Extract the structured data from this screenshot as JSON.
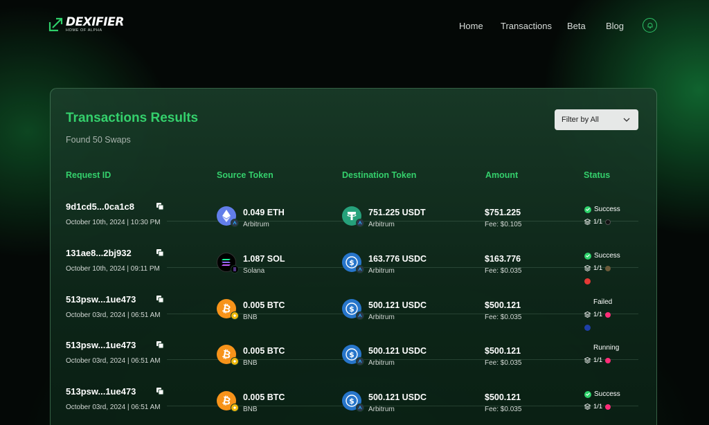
{
  "brand": {
    "name": "DEXIFIER",
    "tagline": "HOME OF ALPHA",
    "accent": "#34d06c"
  },
  "nav": {
    "items": [
      "Home",
      "Transactions",
      "Beta",
      "Blog"
    ],
    "bell_icon": "bell-icon"
  },
  "results": {
    "title": "Transactions Results",
    "subtitle": "Found 50 Swaps",
    "filter_label": "Filter by All",
    "columns": [
      "Request ID",
      "Source Token",
      "Destination Token",
      "Amount",
      "Status"
    ],
    "rows": [
      {
        "id": "9d1cd5...0ca1c8",
        "date": "October 10th, 2024 | 10:30 PM",
        "src_amount": "0.049 ETH",
        "src_network": "Arbitrum",
        "src_icon": "eth-icon",
        "dst_amount": "751.225 USDT",
        "dst_network": "Arbitrum",
        "dst_icon": "usdt-icon",
        "price": "$751.225",
        "fee": "Fee: $0.105",
        "status": "Success",
        "steps": "1/1"
      },
      {
        "id": "131ae8...2bj932",
        "date": "October 10th, 2024 | 09:11 PM",
        "src_amount": "1.087 SOL",
        "src_network": "Solana",
        "src_icon": "sol-icon",
        "dst_amount": "163.776 USDC",
        "dst_network": "Arbitrum",
        "dst_icon": "usdc-icon",
        "price": "$163.776",
        "fee": "Fee: $0.035",
        "status": "Success",
        "steps": "1/1"
      },
      {
        "id": "513psw...1ue473",
        "date": "October 03rd, 2024 | 06:51 AM",
        "src_amount": "0.005 BTC",
        "src_network": "BNB",
        "src_icon": "btc-icon",
        "dst_amount": "500.121 USDC",
        "dst_network": "Arbitrum",
        "dst_icon": "usdc-icon",
        "price": "$500.121",
        "fee": "Fee: $0.035",
        "status": "Failed",
        "steps": "1/1"
      },
      {
        "id": "513psw...1ue473",
        "date": "October 03rd, 2024 | 06:51 AM",
        "src_amount": "0.005 BTC",
        "src_network": "BNB",
        "src_icon": "btc-icon",
        "dst_amount": "500.121 USDC",
        "dst_network": "Arbitrum",
        "dst_icon": "usdc-icon",
        "price": "$500.121",
        "fee": "Fee: $0.035",
        "status": "Running",
        "steps": "1/1"
      },
      {
        "id": "513psw...1ue473",
        "date": "October 03rd, 2024 | 06:51 AM",
        "src_amount": "0.005 BTC",
        "src_network": "BNB",
        "src_icon": "btc-icon",
        "dst_amount": "500.121 USDC",
        "dst_network": "Arbitrum",
        "dst_icon": "usdc-icon",
        "price": "$500.121",
        "fee": "Fee: $0.035",
        "status": "Success",
        "steps": "1/1"
      }
    ]
  },
  "colors": {
    "success": "#2ed36b",
    "failed": "#e53935",
    "eth": "#627eea",
    "usdt": "#26a17b",
    "usdc": "#2775ca",
    "btc": "#f7931a",
    "sol": "#000000"
  }
}
